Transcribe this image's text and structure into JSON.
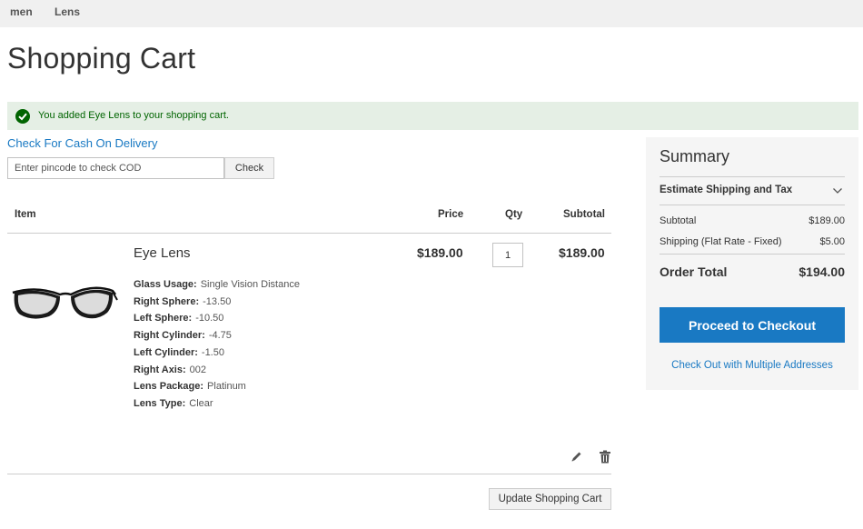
{
  "nav": {
    "items": [
      "men",
      "Lens"
    ]
  },
  "page_title": "Shopping Cart",
  "message": {
    "text": "You added Eye Lens to your shopping cart.",
    "status_color": "#006400"
  },
  "cod": {
    "link_label": "Check For Cash On Delivery",
    "placeholder": "Enter pincode to check COD",
    "button_label": "Check"
  },
  "cart": {
    "headers": {
      "item": "Item",
      "price": "Price",
      "qty": "Qty",
      "subtotal": "Subtotal"
    },
    "item": {
      "name": "Eye Lens",
      "price": "$189.00",
      "qty": "1",
      "subtotal": "$189.00",
      "options": [
        {
          "label": "Glass Usage:",
          "value": "Single Vision Distance"
        },
        {
          "label": "Right Sphere:",
          "value": "-13.50"
        },
        {
          "label": "Left Sphere:",
          "value": "-10.50"
        },
        {
          "label": "Right Cylinder:",
          "value": "-4.75"
        },
        {
          "label": "Left Cylinder:",
          "value": "-1.50"
        },
        {
          "label": "Right Axis:",
          "value": "002"
        },
        {
          "label": "Lens Package:",
          "value": "Platinum"
        },
        {
          "label": "Lens Type:",
          "value": "Clear"
        }
      ]
    },
    "update_label": "Update Shopping Cart"
  },
  "summary": {
    "title": "Summary",
    "estimate_label": "Estimate Shipping and Tax",
    "subtotal_label": "Subtotal",
    "subtotal_value": "$189.00",
    "shipping_label": "Shipping (Flat Rate - Fixed)",
    "shipping_value": "$5.00",
    "total_label": "Order Total",
    "total_value": "$194.00",
    "checkout_label": "Proceed to Checkout",
    "multi_label": "Check Out with Multiple Addresses"
  },
  "colors": {
    "accent": "#1979c3",
    "success_bg": "#e5efe5",
    "success_text": "#006400"
  }
}
